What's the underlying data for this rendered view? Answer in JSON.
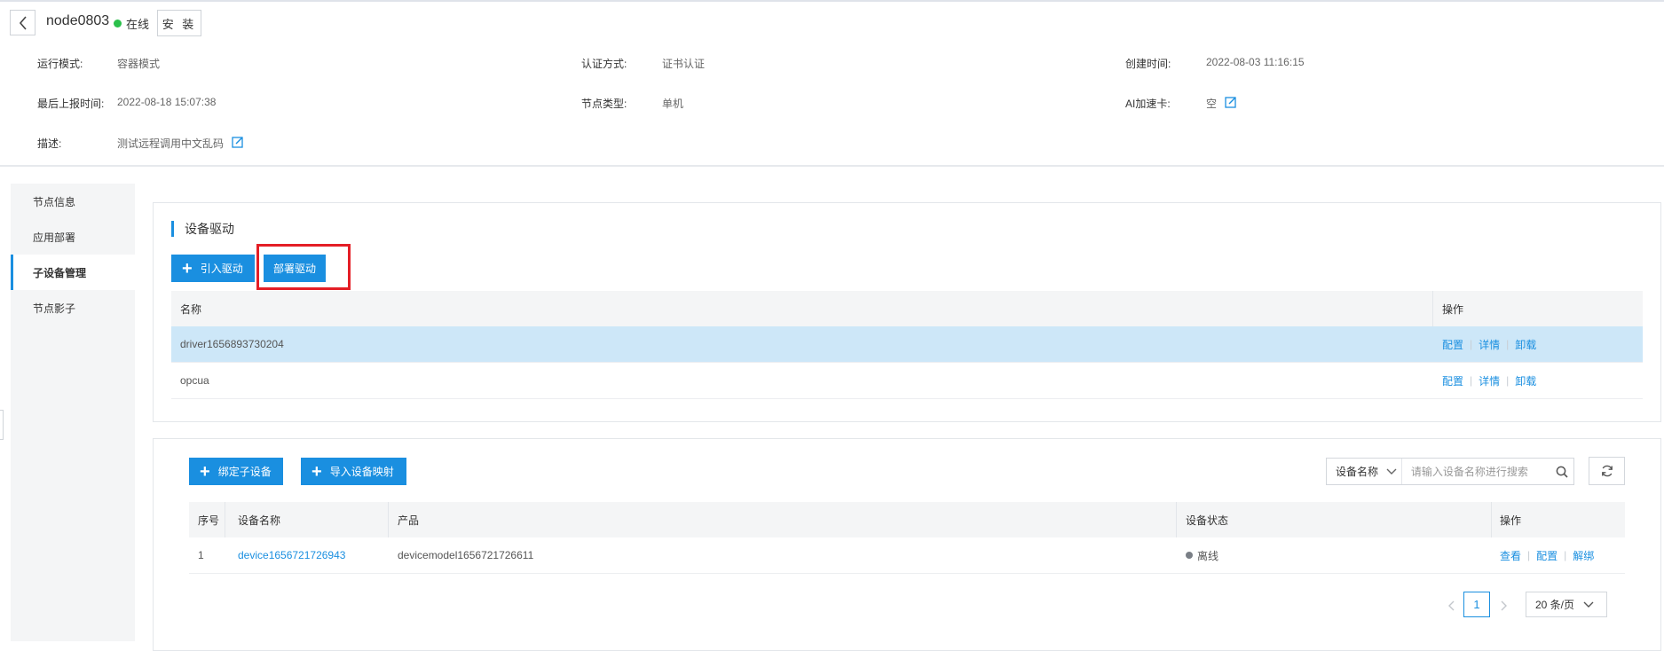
{
  "header": {
    "node_name": "node0803",
    "status": "在线",
    "install_label": "安 装",
    "colors": {
      "online": "#2bc04b",
      "accent": "#1a8fe0",
      "highlight": "#e41e26"
    }
  },
  "meta": {
    "run_mode_label": "运行模式:",
    "run_mode_value": "容器模式",
    "auth_label": "认证方式:",
    "auth_value": "证书认证",
    "created_label": "创建时间:",
    "created_value": "2022-08-03 11:16:15",
    "last_report_label": "最后上报时间:",
    "last_report_value": "2022-08-18 15:07:38",
    "node_type_label": "节点类型:",
    "node_type_value": "单机",
    "ai_card_label": "AI加速卡:",
    "ai_card_value": "空",
    "desc_label": "描述:",
    "desc_value": "测试远程调用中文乱码"
  },
  "nav": {
    "items": [
      {
        "label": "节点信息"
      },
      {
        "label": "应用部署"
      },
      {
        "label": "子设备管理"
      },
      {
        "label": "节点影子"
      }
    ],
    "active_label": "子设备管理"
  },
  "drivers": {
    "title": "设备驱动",
    "import_label": "引入驱动",
    "deploy_label": "部署驱动",
    "col_name": "名称",
    "col_ops": "操作",
    "rows": [
      {
        "name": "driver1656893730204",
        "ops": [
          "配置",
          "详情",
          "卸载"
        ]
      },
      {
        "name": "opcua",
        "ops": [
          "配置",
          "详情",
          "卸载"
        ]
      }
    ]
  },
  "subdevices": {
    "bind_label": "绑定子设备",
    "import_map_label": "导入设备映射",
    "search_field": "设备名称",
    "search_placeholder": "请输入设备名称进行搜索",
    "columns": {
      "index": "序号",
      "name": "设备名称",
      "product": "产品",
      "status": "设备状态",
      "ops": "操作"
    },
    "rows": [
      {
        "index": "1",
        "name": "device1656721726943",
        "product": "devicemodel1656721726611",
        "status": "离线",
        "ops": [
          "查看",
          "配置",
          "解绑"
        ]
      }
    ]
  },
  "pagination": {
    "current": "1",
    "page_size": "20 条/页"
  }
}
